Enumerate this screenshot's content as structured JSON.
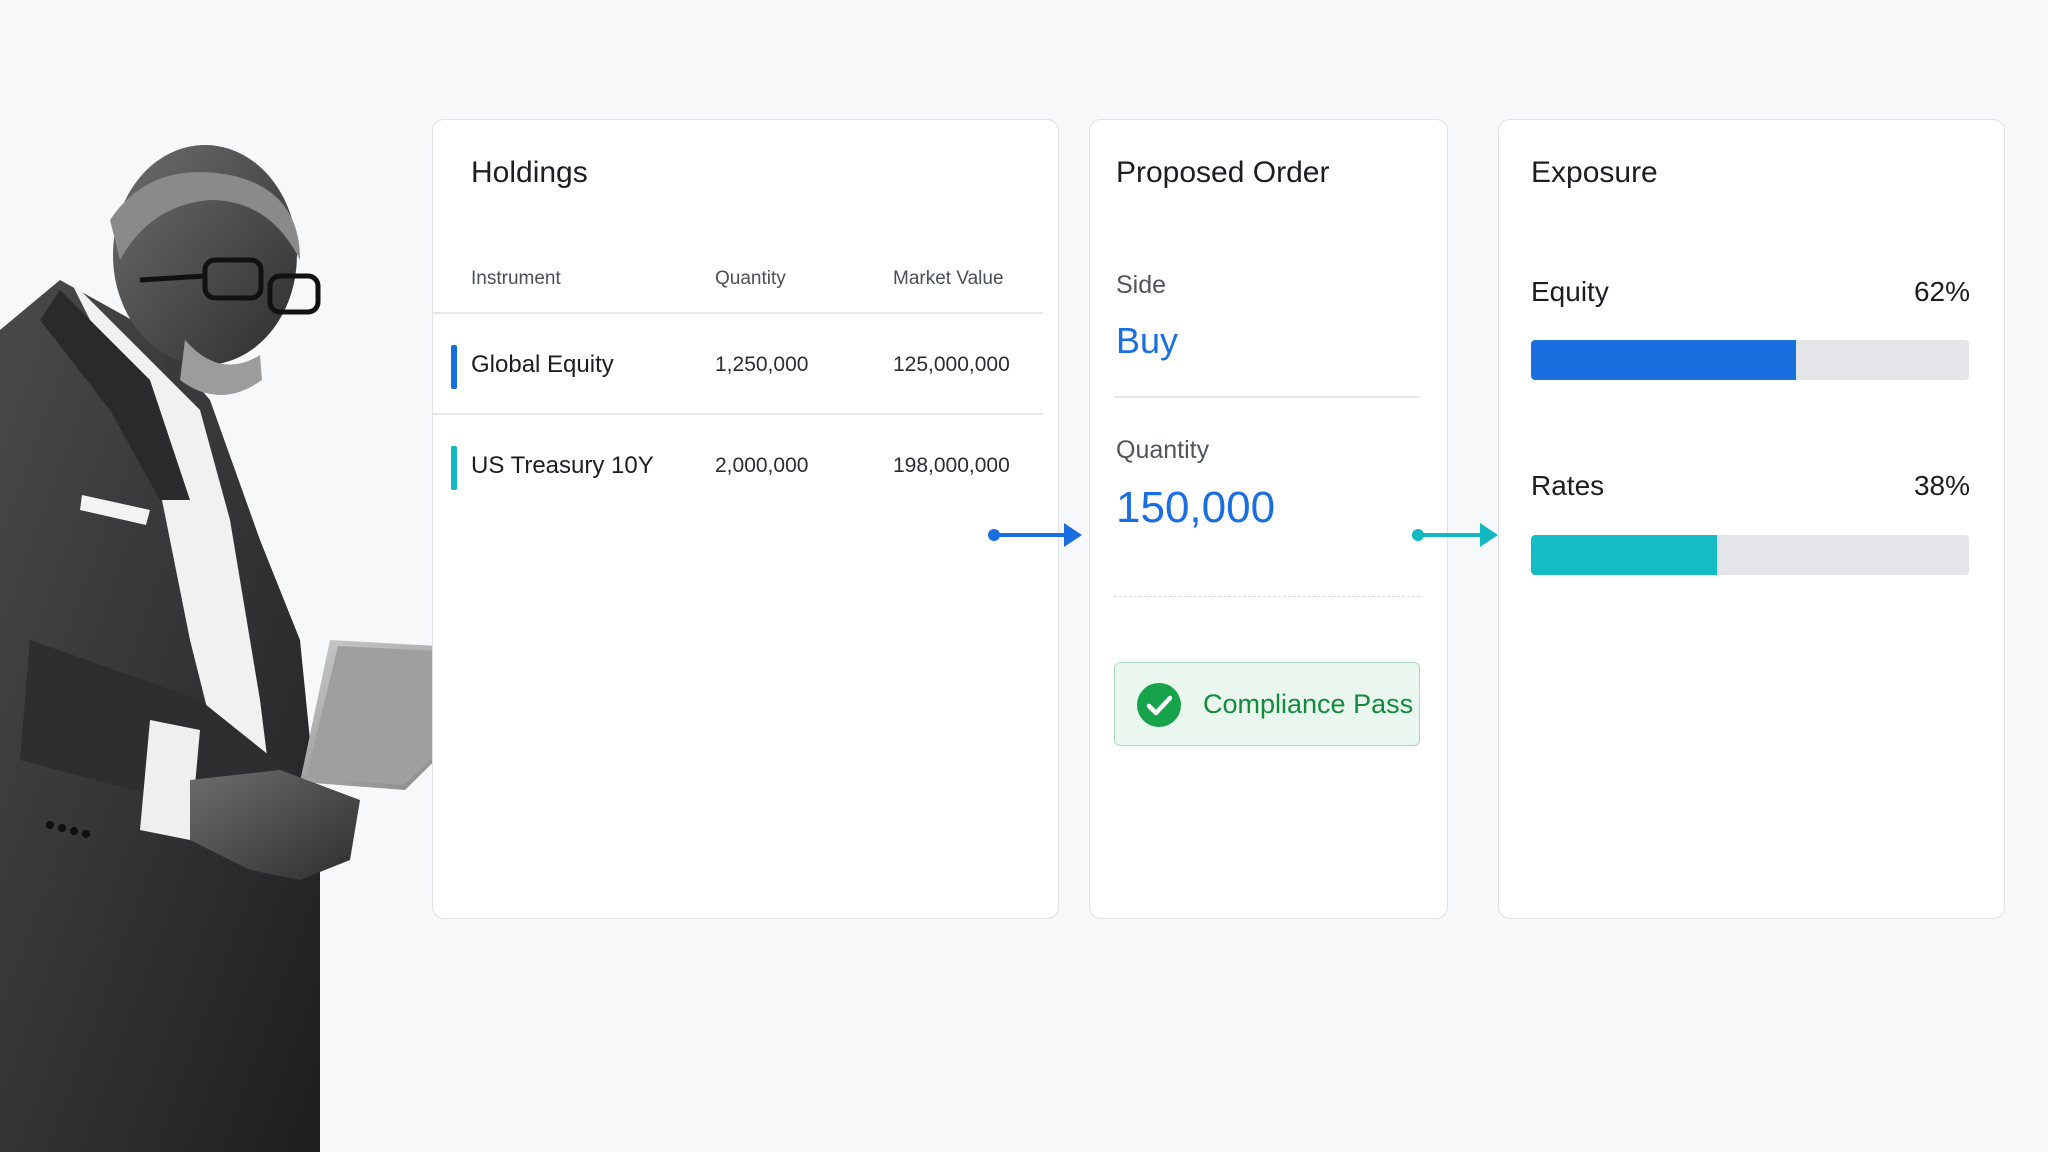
{
  "holdings": {
    "title": "Holdings",
    "columns": [
      "Instrument",
      "Quantity",
      "Market Value"
    ],
    "rows": [
      {
        "instrument": "Global Equity",
        "quantity": "1,250,000",
        "market_value": "125,000,000",
        "accent": "#1a6fe0"
      },
      {
        "instrument": "US Treasury 10Y",
        "quantity": "2,000,000",
        "market_value": "198,000,000",
        "accent": "#12b8c2"
      }
    ]
  },
  "order": {
    "title": "Proposed Order",
    "side_label": "Side",
    "side_value": "Buy",
    "quantity_label": "Quantity",
    "quantity_value": "150,000",
    "compliance": "Compliance Pass"
  },
  "exposure": {
    "title": "Exposure",
    "items": [
      {
        "label": "Equity",
        "pct_text": "62%",
        "fraction": 0.605,
        "color": "#1a6fe0"
      },
      {
        "label": "Rates",
        "pct_text": "38%",
        "fraction": 0.425,
        "color": "#14bcc4"
      }
    ]
  },
  "colors": {
    "blue_arrow": "#1a6fe0",
    "teal_arrow": "#12b8c2",
    "pass_green": "#16a34a"
  },
  "icons": [
    "check-circle-icon",
    "arrow-right-icon"
  ]
}
